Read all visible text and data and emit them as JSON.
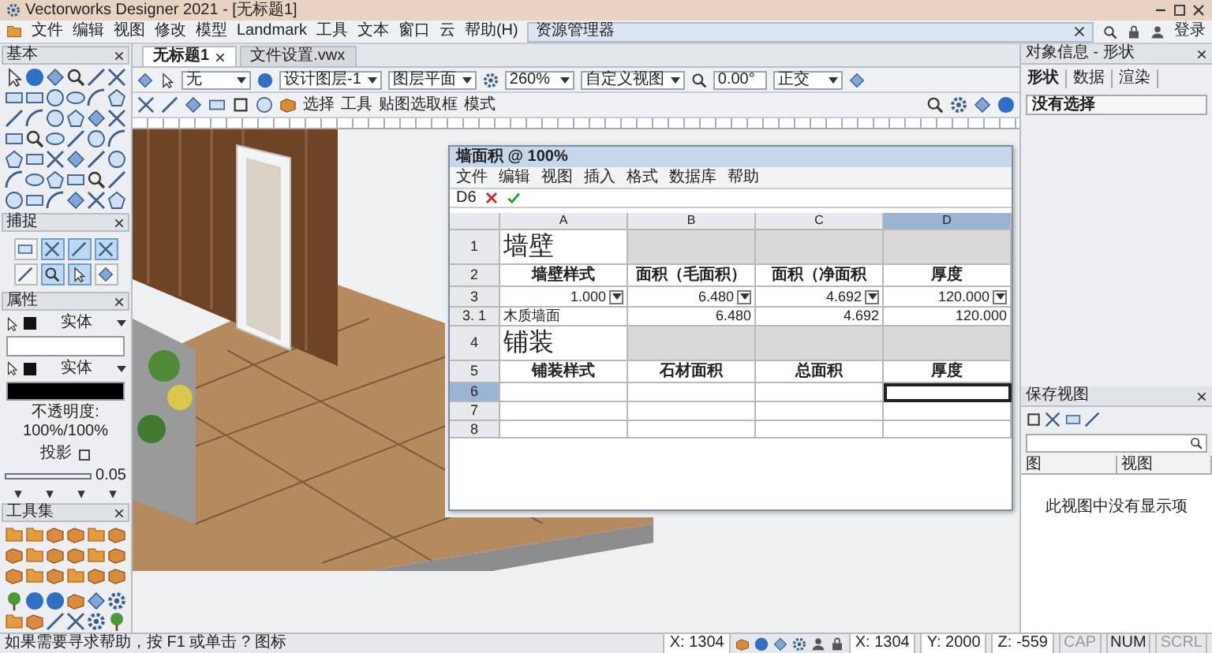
{
  "window": {
    "title": "Vectorworks Designer 2021 - [无标题1]"
  },
  "menu_bar": {
    "items": [
      "文件",
      "编辑",
      "视图",
      "修改",
      "模型",
      "Landmark",
      "工具",
      "文本",
      "窗口",
      "云",
      "帮助(H)"
    ],
    "login": "登录"
  },
  "resource_manager": {
    "title": "资源管理器"
  },
  "tabs": [
    {
      "label": "无标题1",
      "selected": true
    },
    {
      "label": "文件设置.vwx",
      "selected": false
    }
  ],
  "view_bar": {
    "fields": [
      {
        "kind": "dropdown",
        "value": "无"
      },
      {
        "kind": "dropdown",
        "value": "设计图层-1"
      },
      {
        "kind": "dropdown",
        "value": "图层平面"
      },
      {
        "kind": "dropdown",
        "value": "260%"
      },
      {
        "kind": "dropdown",
        "value": "自定义视图"
      },
      {
        "kind": "input",
        "value": "0.00°"
      },
      {
        "kind": "dropdown",
        "value": "正交"
      }
    ]
  },
  "mode_bar": {
    "labels": [
      "选择",
      "工具",
      "贴图选取框",
      "模式"
    ]
  },
  "basic_palette": {
    "title": "基本"
  },
  "snap_palette": {
    "title": "捕捉",
    "buttons": [
      {
        "on": false
      },
      {
        "on": true
      },
      {
        "on": true
      },
      {
        "on": true
      },
      {
        "on": false
      },
      {
        "on": true
      },
      {
        "on": true
      },
      {
        "on": false
      }
    ]
  },
  "attributes": {
    "title": "属性",
    "fill_style": "实体",
    "pen_style": "实体",
    "opacity": "不透明度: 100%/100%",
    "shadow": "投影",
    "line_weight": "0.05"
  },
  "toolsets": {
    "title": "工具集"
  },
  "spreadsheet": {
    "title": "墙面积 @ 100%",
    "menu": [
      "文件",
      "编辑",
      "视图",
      "插入",
      "格式",
      "数据库",
      "帮助"
    ],
    "cell_ref": "D6",
    "columns": [
      {
        "label": "A",
        "selected": false
      },
      {
        "label": "B",
        "selected": false
      },
      {
        "label": "C",
        "selected": false
      },
      {
        "label": "D",
        "selected": true
      }
    ],
    "rows": [
      {
        "header": "1",
        "kind": "title",
        "title": "墙壁",
        "selected": false
      },
      {
        "header": "2",
        "kind": "labels",
        "cells": [
          "墙壁样式",
          "面积（毛面积）",
          "面积（净面积",
          "厚度"
        ],
        "selected": false
      },
      {
        "header": "3",
        "kind": "values",
        "cells": [
          "1.000",
          "6.480",
          "4.692",
          "120.000"
        ],
        "selected": false
      },
      {
        "header": "3. 1",
        "kind": "subrow",
        "cells": [
          "木质墙面",
          "6.480",
          "4.692",
          "120.000"
        ],
        "selected": false
      },
      {
        "header": "4",
        "kind": "title",
        "title": "铺装",
        "selected": false
      },
      {
        "header": "5",
        "kind": "labels",
        "cells": [
          "铺装样式",
          "石材面积",
          "总面积",
          "厚度"
        ],
        "selected": false
      },
      {
        "header": "6",
        "kind": "blank",
        "selected": true
      },
      {
        "header": "7",
        "kind": "blank",
        "selected": false
      },
      {
        "header": "8",
        "kind": "blank",
        "selected": false
      }
    ]
  },
  "object_info": {
    "title": "对象信息 - 形状",
    "tabs": [
      {
        "label": "形状",
        "selected": true
      },
      {
        "label": "数据",
        "selected": false
      },
      {
        "label": "渲染",
        "selected": false
      }
    ],
    "message": "没有选择"
  },
  "saved_views": {
    "title": "保存视图",
    "columns": [
      "图",
      "视图"
    ],
    "message": "此视图中没有显示项"
  },
  "status_bar": {
    "help": "如果需要寻求帮助，按 F1 或单击 ? 图标",
    "x_field": "X: 1304",
    "coords": [
      "X: 1304",
      "Y: 2000",
      "Z: -559"
    ],
    "indicators": [
      {
        "label": "CAP",
        "on": false
      },
      {
        "label": "NUM",
        "on": true
      },
      {
        "label": "SCRL",
        "on": false
      }
    ]
  }
}
